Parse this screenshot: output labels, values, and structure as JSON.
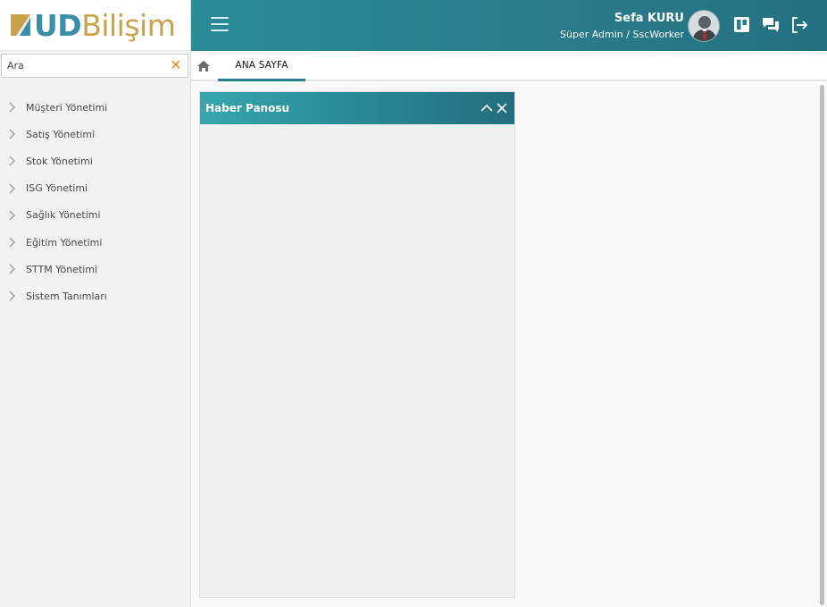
{
  "logo": {
    "text_ud": "UD",
    "text_rest": "Bilişim"
  },
  "search": {
    "placeholder": "Ara",
    "value": ""
  },
  "menu": {
    "items": [
      {
        "label": "Müşteri Yönetimi"
      },
      {
        "label": "Satış Yönetimi"
      },
      {
        "label": "Stok Yönetimi"
      },
      {
        "label": "ISG Yönetimi"
      },
      {
        "label": "Sağlık Yönetimi"
      },
      {
        "label": "Eğitim Yönetimi"
      },
      {
        "label": "STTM Yönetimi"
      },
      {
        "label": "Sistem Tanımları"
      }
    ]
  },
  "header": {
    "user_name": "Sefa KURU",
    "user_role": "Süper Admin / SscWorker",
    "icons": [
      "menu-icon",
      "avatar",
      "board-icon",
      "chat-icon",
      "logout-icon"
    ]
  },
  "tabs": [
    {
      "label": "ANA SAYFA",
      "active": true
    }
  ],
  "panel": {
    "title": "Haber Panosu"
  },
  "colors": {
    "accent": "#2a7d8b",
    "clear": "#f08a24",
    "logo_blue": "#3a8fa8",
    "logo_gold": "#c8a24a"
  }
}
